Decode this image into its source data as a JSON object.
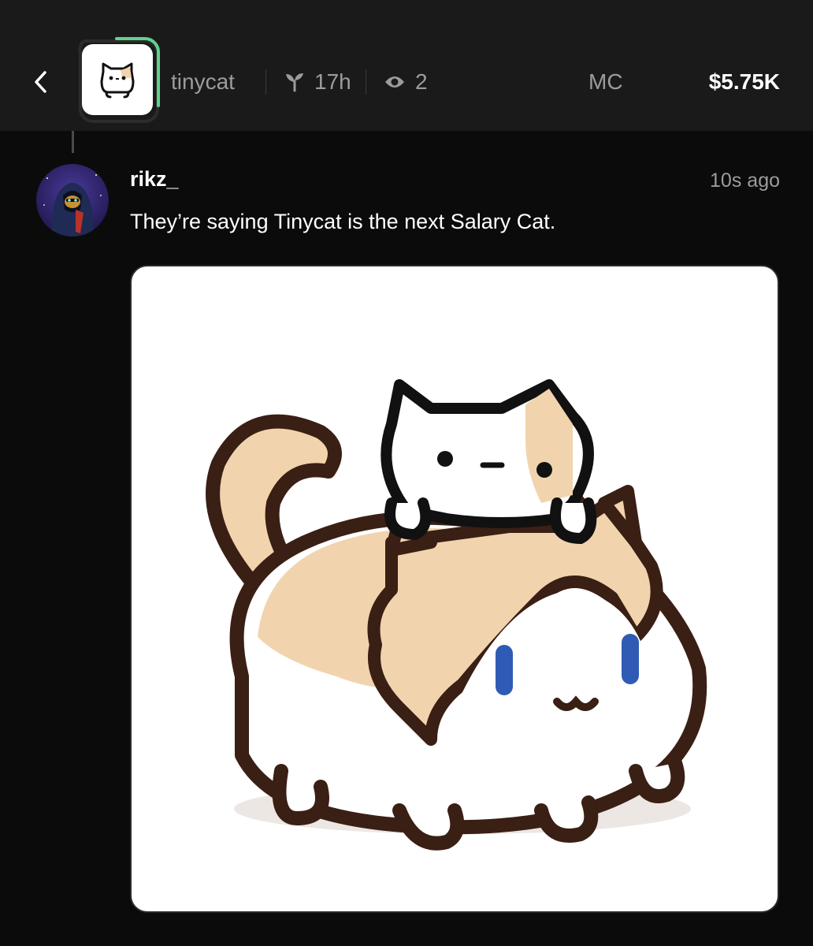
{
  "header": {
    "token_name": "tinycat",
    "age": "17h",
    "views": "2",
    "market_cap_label": "MC",
    "market_cap_value": "$5.75K"
  },
  "post": {
    "username": "rikz_",
    "time": "10s ago",
    "text": "They’re saying Tinycat is the next Salary Cat."
  },
  "colors": {
    "accent_ring": "#5fd38d",
    "cat_outline": "#3a1f14",
    "cat_tan": "#f1d4ae",
    "cat_eye": "#2f5bb5"
  }
}
